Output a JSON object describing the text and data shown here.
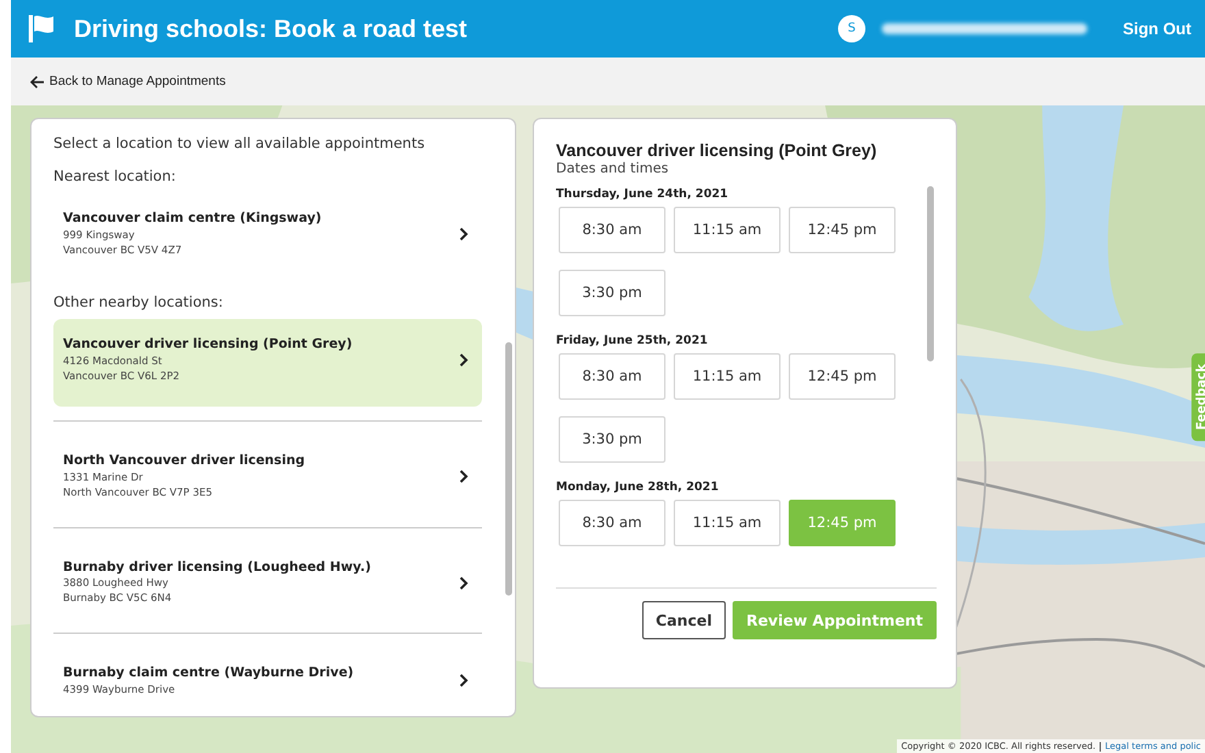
{
  "header": {
    "title": "Driving schools: Book a road test",
    "avatar_initial": "S",
    "sign_out": "Sign Out"
  },
  "back_link": "Back to Manage Appointments",
  "locations": {
    "intro": "Select a location to view all available appointments",
    "sections": [
      {
        "heading": "Nearest location:",
        "items": [
          {
            "name": "Vancouver claim centre (Kingsway)",
            "address": "999 Kingsway",
            "city": "Vancouver BC V5V 4Z7",
            "selected": false
          }
        ]
      },
      {
        "heading": "Other nearby locations:",
        "items": [
          {
            "name": "Vancouver driver licensing (Point Grey)",
            "address": "4126 Macdonald St",
            "city": "Vancouver BC V6L 2P2",
            "selected": true
          },
          {
            "name": "North Vancouver driver licensing",
            "address": "1331 Marine Dr",
            "city": "North Vancouver BC V7P 3E5",
            "selected": false
          },
          {
            "name": "Burnaby driver licensing (Lougheed Hwy.)",
            "address": "3880 Lougheed Hwy",
            "city": "Burnaby BC V5C 6N4",
            "selected": false
          },
          {
            "name": "Burnaby claim centre (Wayburne Drive)",
            "address": "4399 Wayburne Drive",
            "selected": false
          }
        ]
      }
    ]
  },
  "schedule": {
    "title": "Vancouver driver licensing (Point Grey)",
    "subtitle": "Dates and times",
    "days": [
      {
        "date": "Thursday, June 24th, 2021",
        "slots": [
          {
            "time": "8:30 am",
            "selected": false
          },
          {
            "time": "11:15 am",
            "selected": false
          },
          {
            "time": "12:45 pm",
            "selected": false
          },
          {
            "time": "3:30 pm",
            "selected": false
          }
        ]
      },
      {
        "date": "Friday, June 25th, 2021",
        "slots": [
          {
            "time": "8:30 am",
            "selected": false
          },
          {
            "time": "11:15 am",
            "selected": false
          },
          {
            "time": "12:45 pm",
            "selected": false
          },
          {
            "time": "3:30 pm",
            "selected": false
          }
        ]
      },
      {
        "date": "Monday, June 28th, 2021",
        "slots": [
          {
            "time": "8:30 am",
            "selected": false
          },
          {
            "time": "11:15 am",
            "selected": false
          },
          {
            "time": "12:45 pm",
            "selected": true
          }
        ]
      }
    ],
    "cancel": "Cancel",
    "review": "Review Appointment"
  },
  "feedback": "Feedback",
  "footer": {
    "copyright": "Copyright © 2020 ICBC. All rights reserved.",
    "link": "Legal terms and polic"
  }
}
